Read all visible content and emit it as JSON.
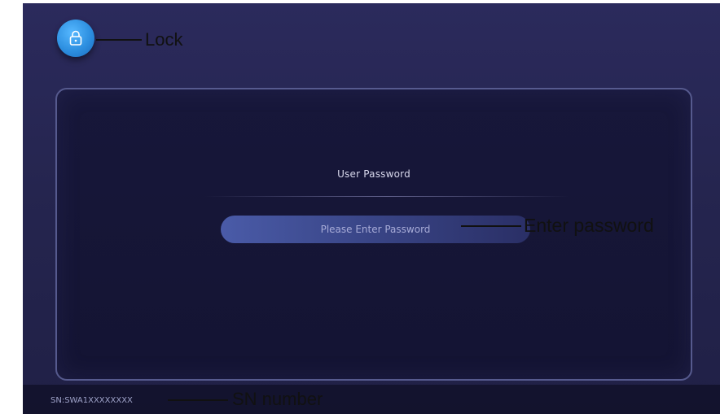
{
  "panel": {
    "title": "User Password",
    "password_placeholder": "Please Enter Password"
  },
  "footer": {
    "serial_number": "SN:SWA1XXXXXXXX"
  },
  "annotations": {
    "lock": "Lock",
    "enter_password": "Enter password",
    "sn_number": "SN number"
  },
  "colors": {
    "screen_bg": "#25254f",
    "panel_bg": "#17173a",
    "panel_border": "#565a8e",
    "input_accent": "#4a5ba8",
    "lock_button": "#2d8fe0"
  },
  "icons": {
    "lock": "lock-icon"
  }
}
